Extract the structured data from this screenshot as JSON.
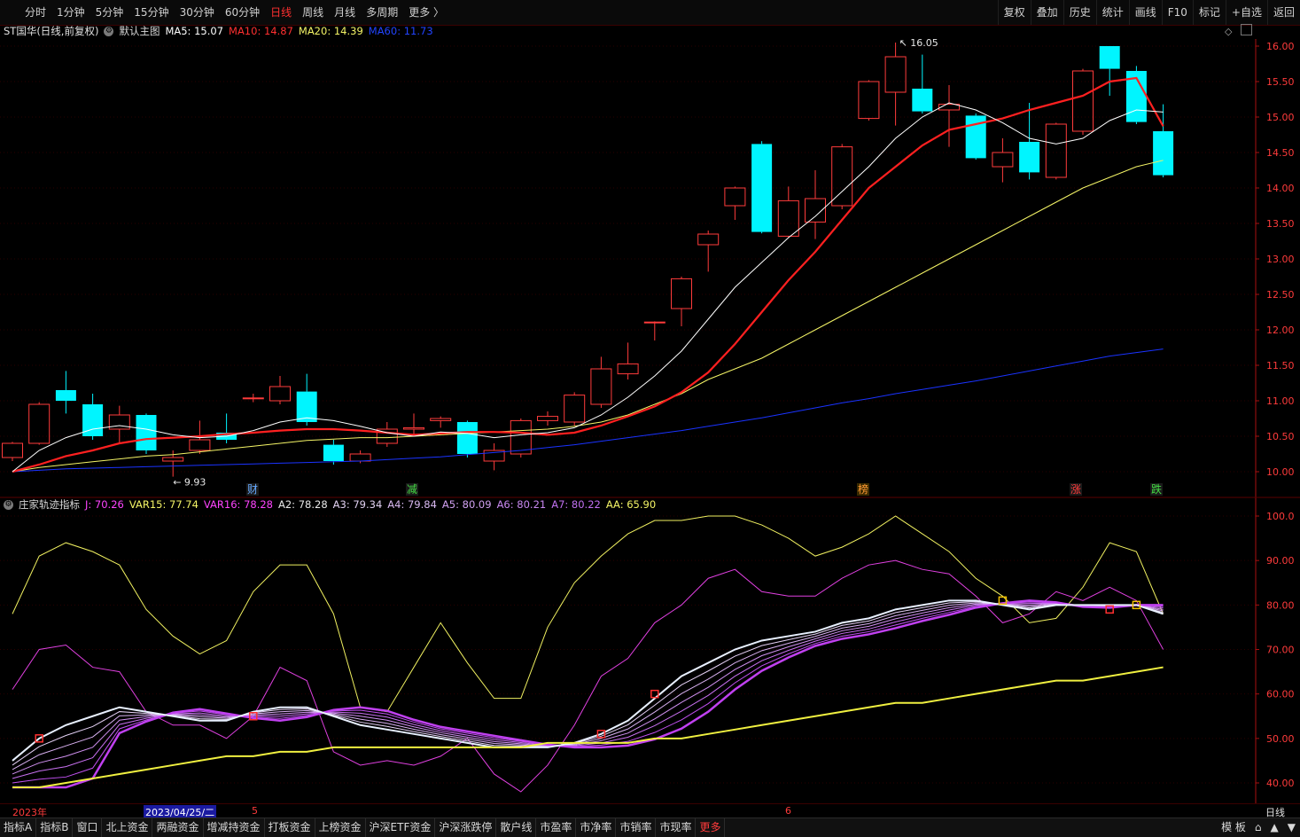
{
  "toolbar": {
    "periods": [
      "分时",
      "1分钟",
      "5分钟",
      "15分钟",
      "30分钟",
      "60分钟",
      "日线",
      "周线",
      "月线",
      "多周期",
      "更多 〉"
    ],
    "active_period": "日线",
    "tools": [
      "复权",
      "叠加",
      "历史",
      "统计",
      "画线",
      "F10",
      "标记",
      "+自选",
      "返回"
    ]
  },
  "main_legend": {
    "title": "ST国华(日线,前复权)",
    "template": "默认主图",
    "ma5": "MA5: 15.07",
    "ma10": "MA10: 14.87",
    "ma20": "MA20: 14.39",
    "ma60": "MA60: 11.73"
  },
  "colors": {
    "up": "#ff3b3b",
    "down": "#00f5ff",
    "ma5": "#ffffff",
    "ma10": "#ff2020",
    "ma20": "#f4f466",
    "ma60": "#1a33ff"
  },
  "annotations": {
    "high": "16.05",
    "low": "9.93"
  },
  "price_axis": [
    "16.00",
    "15.50",
    "15.00",
    "14.50",
    "14.00",
    "13.50",
    "13.00",
    "12.50",
    "12.00",
    "11.50",
    "11.00",
    "10.50",
    "10.00"
  ],
  "events": [
    {
      "label": "财",
      "color": "#66aaff"
    },
    {
      "label": "减",
      "color": "#44dd44"
    },
    {
      "label": "榜",
      "color": "#ff9933"
    },
    {
      "label": "涨",
      "color": "#ff3b3b"
    },
    {
      "label": "跌",
      "color": "#44dd44"
    }
  ],
  "indicator_legend": {
    "name": "庄家轨迹指标",
    "j": "J: 70.26",
    "var15": "VAR15: 77.74",
    "var16": "VAR16: 78.28",
    "a2": "A2: 78.28",
    "a3": "A3: 79.34",
    "a4": "A4: 79.84",
    "a5": "A5: 80.09",
    "a6": "A6: 80.21",
    "a7": "A7: 80.22",
    "aa": "AA: 65.90"
  },
  "indicator_axis": [
    "100.0",
    "90.00",
    "80.00",
    "70.00",
    "60.00",
    "50.00",
    "40.00"
  ],
  "dates": {
    "year": "2023年",
    "cursor": "2023/04/25/二",
    "may": "5",
    "june": "6",
    "period": "日线"
  },
  "bottom_tabs": [
    "指标A",
    "指标B",
    "窗口",
    "北上资金",
    "两融资金",
    "增减持资金",
    "打板资金",
    "上榜资金",
    "沪深ETF资金",
    "沪深涨跌停",
    "散户线",
    "市盈率",
    "市净率",
    "市销率",
    "市现率",
    "更多"
  ],
  "bottom_right": [
    "模 板",
    "⌂",
    "▲",
    "▼"
  ],
  "chart_data": {
    "type": "candlestick",
    "candles": [
      {
        "o": 10.2,
        "c": 10.4,
        "h": 10.42,
        "l": 10.15
      },
      {
        "o": 10.4,
        "c": 10.95,
        "h": 10.98,
        "l": 10.38
      },
      {
        "o": 11.15,
        "c": 11.0,
        "h": 11.42,
        "l": 10.82
      },
      {
        "o": 10.95,
        "c": 10.5,
        "h": 11.1,
        "l": 10.45
      },
      {
        "o": 10.6,
        "c": 10.8,
        "h": 10.93,
        "l": 10.4
      },
      {
        "o": 10.8,
        "c": 10.3,
        "h": 10.82,
        "l": 10.25
      },
      {
        "o": 10.15,
        "c": 10.2,
        "h": 10.3,
        "l": 9.93
      },
      {
        "o": 10.3,
        "c": 10.45,
        "h": 10.72,
        "l": 10.25
      },
      {
        "o": 10.55,
        "c": 10.45,
        "h": 10.82,
        "l": 10.4
      },
      {
        "o": 11.03,
        "c": 11.04,
        "h": 11.1,
        "l": 10.98
      },
      {
        "o": 11.0,
        "c": 11.2,
        "h": 11.35,
        "l": 10.95
      },
      {
        "o": 11.13,
        "c": 10.7,
        "h": 11.38,
        "l": 10.65
      },
      {
        "o": 10.38,
        "c": 10.15,
        "h": 10.45,
        "l": 10.1
      },
      {
        "o": 10.15,
        "c": 10.25,
        "h": 10.3,
        "l": 10.12
      },
      {
        "o": 10.4,
        "c": 10.6,
        "h": 10.7,
        "l": 10.35
      },
      {
        "o": 10.6,
        "c": 10.62,
        "h": 10.82,
        "l": 10.5
      },
      {
        "o": 10.72,
        "c": 10.75,
        "h": 10.78,
        "l": 10.62
      },
      {
        "o": 10.7,
        "c": 10.25,
        "h": 10.72,
        "l": 10.2
      },
      {
        "o": 10.15,
        "c": 10.3,
        "h": 10.4,
        "l": 10.02
      },
      {
        "o": 10.25,
        "c": 10.72,
        "h": 10.75,
        "l": 10.2
      },
      {
        "o": 10.72,
        "c": 10.78,
        "h": 10.85,
        "l": 10.65
      },
      {
        "o": 10.7,
        "c": 11.08,
        "h": 11.12,
        "l": 10.65
      },
      {
        "o": 10.95,
        "c": 11.45,
        "h": 11.62,
        "l": 10.9
      },
      {
        "o": 11.38,
        "c": 11.52,
        "h": 11.82,
        "l": 11.3
      },
      {
        "o": 12.1,
        "c": 12.11,
        "h": 12.12,
        "l": 11.85
      },
      {
        "o": 12.3,
        "c": 12.72,
        "h": 12.75,
        "l": 12.05
      },
      {
        "o": 13.2,
        "c": 13.35,
        "h": 13.4,
        "l": 12.82
      },
      {
        "o": 13.75,
        "c": 14.0,
        "h": 14.02,
        "l": 13.55
      },
      {
        "o": 14.62,
        "c": 13.38,
        "h": 14.66,
        "l": 13.36
      },
      {
        "o": 13.32,
        "c": 13.82,
        "h": 14.02,
        "l": 13.3
      },
      {
        "o": 13.52,
        "c": 13.85,
        "h": 14.25,
        "l": 13.28
      },
      {
        "o": 13.75,
        "c": 14.58,
        "h": 14.62,
        "l": 13.7
      },
      {
        "o": 14.98,
        "c": 15.5,
        "h": 15.52,
        "l": 14.95
      },
      {
        "o": 15.35,
        "c": 15.85,
        "h": 16.05,
        "l": 14.88
      },
      {
        "o": 15.4,
        "c": 15.08,
        "h": 15.88,
        "l": 15.05
      },
      {
        "o": 15.1,
        "c": 15.18,
        "h": 15.45,
        "l": 14.58
      },
      {
        "o": 15.02,
        "c": 14.42,
        "h": 15.05,
        "l": 14.4
      },
      {
        "o": 14.3,
        "c": 14.5,
        "h": 14.7,
        "l": 14.08
      },
      {
        "o": 14.65,
        "c": 14.22,
        "h": 15.2,
        "l": 14.12
      },
      {
        "o": 14.15,
        "c": 14.9,
        "h": 14.92,
        "l": 14.12
      },
      {
        "o": 14.8,
        "c": 15.65,
        "h": 15.68,
        "l": 14.75
      },
      {
        "o": 16.0,
        "c": 15.68,
        "h": 16.0,
        "l": 15.3
      },
      {
        "o": 15.65,
        "c": 14.93,
        "h": 15.72,
        "l": 14.9
      },
      {
        "o": 14.8,
        "c": 14.18,
        "h": 15.18,
        "l": 14.15
      }
    ],
    "ma": {
      "ma5": [
        10.0,
        10.3,
        10.48,
        10.6,
        10.65,
        10.6,
        10.52,
        10.48,
        10.5,
        10.58,
        10.7,
        10.76,
        10.72,
        10.64,
        10.55,
        10.5,
        10.56,
        10.54,
        10.48,
        10.52,
        10.55,
        10.62,
        10.8,
        11.05,
        11.35,
        11.7,
        12.15,
        12.6,
        12.95,
        13.3,
        13.6,
        13.95,
        14.3,
        14.7,
        15.0,
        15.2,
        15.1,
        14.92,
        14.7,
        14.62,
        14.7,
        14.95,
        15.1,
        15.07
      ],
      "ma10": [
        10.0,
        10.1,
        10.22,
        10.3,
        10.4,
        10.46,
        10.48,
        10.5,
        10.53,
        10.55,
        10.58,
        10.6,
        10.6,
        10.58,
        10.55,
        10.52,
        10.54,
        10.56,
        10.56,
        10.55,
        10.52,
        10.55,
        10.65,
        10.78,
        10.92,
        11.12,
        11.4,
        11.8,
        12.25,
        12.7,
        13.1,
        13.55,
        14.0,
        14.3,
        14.6,
        14.82,
        14.9,
        14.98,
        15.1,
        15.2,
        15.3,
        15.5,
        15.55,
        14.87
      ],
      "ma20": [
        10.0,
        10.06,
        10.1,
        10.14,
        10.18,
        10.22,
        10.24,
        10.28,
        10.32,
        10.36,
        10.4,
        10.44,
        10.46,
        10.48,
        10.48,
        10.5,
        10.52,
        10.54,
        10.56,
        10.58,
        10.6,
        10.64,
        10.7,
        10.8,
        10.95,
        11.1,
        11.3,
        11.45,
        11.6,
        11.8,
        12.0,
        12.2,
        12.4,
        12.6,
        12.8,
        13.0,
        13.2,
        13.4,
        13.6,
        13.8,
        14.0,
        14.15,
        14.3,
        14.39
      ],
      "ma60": [
        10.0,
        10.02,
        10.04,
        10.05,
        10.06,
        10.07,
        10.08,
        10.09,
        10.1,
        10.11,
        10.12,
        10.13,
        10.14,
        10.15,
        10.17,
        10.19,
        10.21,
        10.24,
        10.27,
        10.3,
        10.34,
        10.38,
        10.43,
        10.48,
        10.53,
        10.58,
        10.64,
        10.7,
        10.76,
        10.83,
        10.9,
        10.97,
        11.03,
        11.1,
        11.16,
        11.22,
        11.28,
        11.35,
        11.42,
        11.49,
        11.56,
        11.63,
        11.68,
        11.73
      ]
    },
    "indicator": {
      "j": [
        61,
        70,
        71,
        66,
        65,
        56,
        53,
        53,
        50,
        55,
        66,
        63,
        47,
        44,
        45,
        44,
        46,
        50,
        42,
        38,
        44,
        53,
        64,
        68,
        76,
        80,
        86,
        88,
        83,
        82,
        82,
        86,
        89,
        90,
        88,
        87,
        82,
        76,
        78,
        83,
        81,
        84,
        81,
        70
      ],
      "var15": [
        78,
        91,
        94,
        92,
        89,
        79,
        73,
        69,
        72,
        83,
        89,
        89,
        78,
        57,
        56,
        66,
        76,
        67,
        59,
        59,
        75,
        85,
        91,
        96,
        99,
        99,
        100,
        100,
        98,
        95,
        91,
        93,
        96,
        100,
        96,
        92,
        86,
        82,
        76,
        77,
        84,
        94,
        92,
        78
      ],
      "white": [
        45,
        50,
        53,
        55,
        57,
        56,
        55,
        54,
        54,
        56,
        57,
        57,
        55,
        53,
        52,
        51,
        50,
        49,
        48,
        48,
        48,
        49,
        51,
        54,
        59,
        64,
        67,
        70,
        72,
        73,
        74,
        76,
        77,
        79,
        80,
        81,
        81,
        80,
        79,
        80,
        80,
        80,
        80,
        78
      ],
      "aa": [
        39,
        39,
        40,
        41,
        42,
        43,
        44,
        45,
        46,
        46,
        47,
        47,
        48,
        48,
        48,
        48,
        48,
        48,
        48,
        48,
        49,
        49,
        49,
        49,
        50,
        50,
        51,
        52,
        53,
        54,
        55,
        56,
        57,
        58,
        58,
        59,
        60,
        61,
        62,
        63,
        63,
        64,
        65,
        66
      ]
    }
  }
}
